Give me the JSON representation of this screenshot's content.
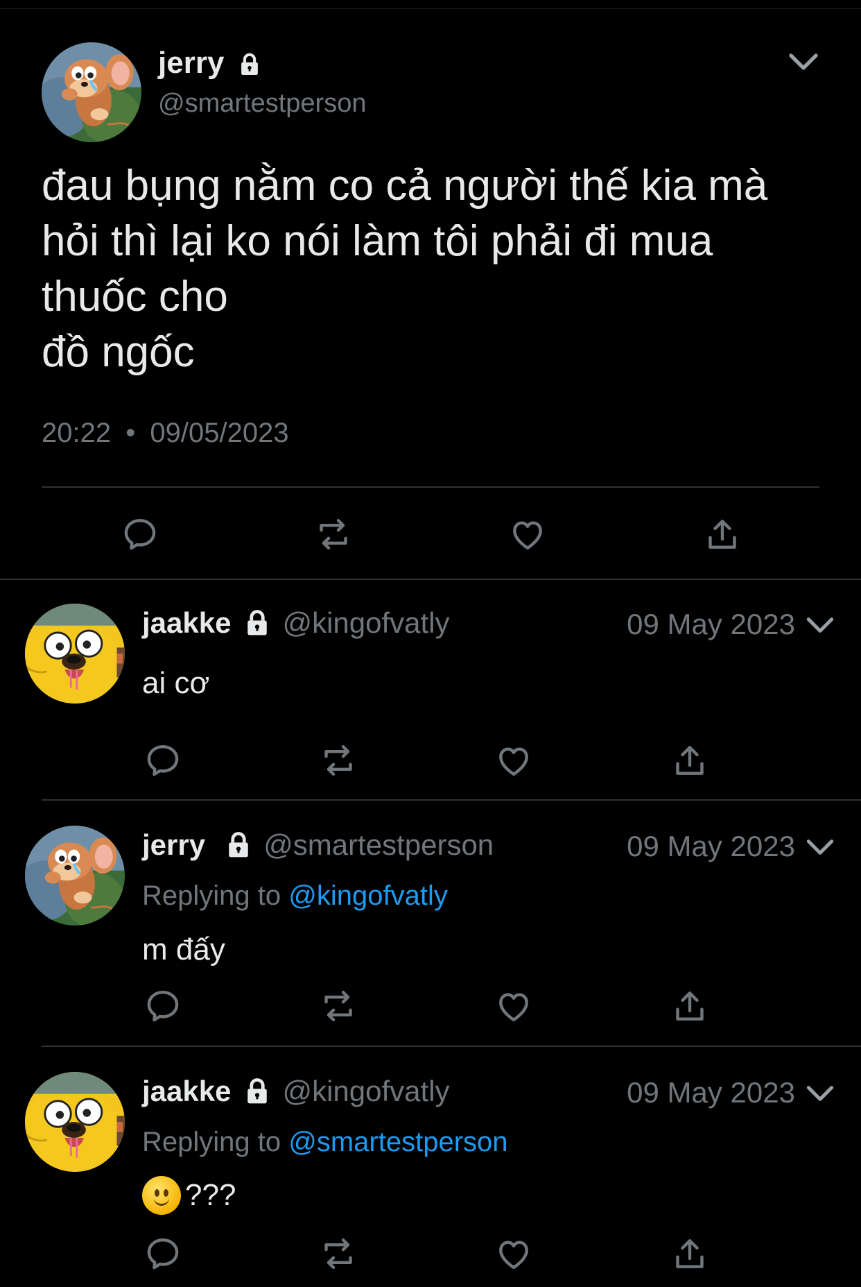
{
  "main_tweet": {
    "name": "jerry",
    "handle": "@smartestperson",
    "text": "đau bụng nằm co cả người thế kia mà\nhỏi thì lại ko nói làm tôi phải đi mua\nthuốc cho\nđồ ngốc",
    "time": "20:22",
    "separator": "•",
    "date": "09/05/2023"
  },
  "replies": [
    {
      "name": "jaakke",
      "handle": "@kingofvatly",
      "date": "09 May 2023",
      "replying_prefix": "",
      "replying_to": "",
      "text": "ai cơ",
      "avatar": "jake"
    },
    {
      "name": "jerry",
      "handle": "@smartestperson",
      "date": "09 May 2023",
      "replying_prefix": "Replying to",
      "replying_to": "@kingofvatly",
      "text": "m đấy",
      "avatar": "jerry"
    },
    {
      "name": "jaakke",
      "handle": "@kingofvatly",
      "date": "09 May 2023",
      "replying_prefix": "Replying to",
      "replying_to": "@smartestperson",
      "text": "???",
      "emoji": "slightly-smiling-face",
      "avatar": "jake"
    }
  ],
  "icons": {
    "reply": "reply-icon",
    "retweet": "retweet-icon",
    "like": "heart-icon",
    "share": "share-icon",
    "lock": "lock-icon",
    "more": "chevron-down-icon"
  },
  "colors": {
    "background": "#000000",
    "text": "#e7e9ea",
    "secondary": "#71767b",
    "link": "#1d9bf0",
    "divider": "#2f3336"
  }
}
